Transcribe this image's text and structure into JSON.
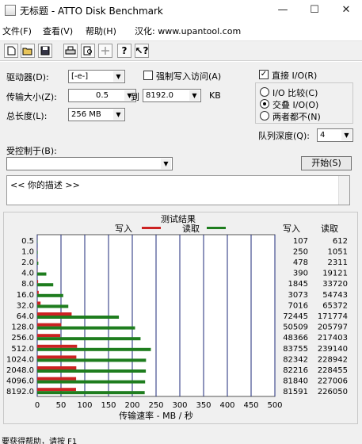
{
  "window": {
    "title": "无标题 - ATTO Disk Benchmark",
    "controls": [
      "—",
      "☐",
      "✕"
    ]
  },
  "menu": {
    "file": "文件(F)",
    "view": "查看(V)",
    "help": "帮助(H)",
    "localized": "汉化: www.upantool.com"
  },
  "toolbar": {
    "icons": [
      "new-icon",
      "open-icon",
      "save-icon",
      "print-icon",
      "print-preview-icon",
      "move-icon",
      "help-icon",
      "context-help-icon"
    ]
  },
  "controls": {
    "drive_label": "驱动器(D):",
    "drive_value": "[-e-]",
    "force_write_label": "强制写入访问(A)",
    "transfer_label": "传输大小(Z):",
    "transfer_from": "0.5",
    "to_label": "到",
    "transfer_to": "8192.0",
    "kb_label": "KB",
    "total_length_label": "总长度(L):",
    "total_length_value": "256 MB",
    "direct_io_label": "直接 I/O(R)",
    "io_compare_label": "I/O 比较(C)",
    "overlapped_io_label": "交叠 I/O(O)",
    "neither_label": "两者都不(N)",
    "queue_depth_label": "队列深度(Q):",
    "queue_depth_value": "4",
    "controlled_by_label": "受控制于(B):",
    "controlled_by_value": "",
    "start_button": "开始(S)",
    "description": "<<  你的描述    >>"
  },
  "results": {
    "header": "测试结果",
    "write_label": "写入",
    "read_label": "读取",
    "col_write": "写入",
    "col_read": "读取",
    "axis_label": "传输速率 - MB / 秒"
  },
  "colors": {
    "write": "#cc2222",
    "read": "#1e7d1e"
  },
  "chart_data": {
    "type": "bar",
    "orientation": "horizontal",
    "categories": [
      "0.5",
      "1.0",
      "2.0",
      "4.0",
      "8.0",
      "16.0",
      "32.0",
      "64.0",
      "128.0",
      "256.0",
      "512.0",
      "1024.0",
      "2048.0",
      "4096.0",
      "8192.0"
    ],
    "series": [
      {
        "name": "写入",
        "values": [
          0.1,
          0.25,
          0.48,
          0.39,
          1.85,
          3.07,
          7.02,
          72.4,
          50.5,
          48.4,
          83.8,
          82.3,
          82.2,
          81.8,
          81.6
        ]
      },
      {
        "name": "读取",
        "values": [
          0.6,
          1.05,
          2.3,
          19.1,
          33.7,
          54.7,
          65.4,
          171.8,
          205.8,
          217.4,
          239.1,
          228.9,
          228.5,
          227.0,
          226.1
        ]
      }
    ],
    "write_table": [
      "107",
      "250",
      "478",
      "390",
      "1845",
      "3073",
      "7016",
      "72445",
      "50509",
      "48366",
      "83755",
      "82342",
      "82216",
      "81840",
      "81591"
    ],
    "read_table": [
      "612",
      "1051",
      "2311",
      "19121",
      "33720",
      "54743",
      "65372",
      "171774",
      "205797",
      "217403",
      "239140",
      "228942",
      "228455",
      "227006",
      "226050"
    ],
    "x_ticks": [
      "0",
      "50",
      "100",
      "150",
      "200",
      "250",
      "300",
      "350",
      "400",
      "450",
      "500"
    ],
    "xlim": [
      0,
      500
    ],
    "xlabel": "传输速率 - MB / 秒",
    "grid": true
  },
  "status": {
    "text": "要获得帮助，请按 F1"
  }
}
